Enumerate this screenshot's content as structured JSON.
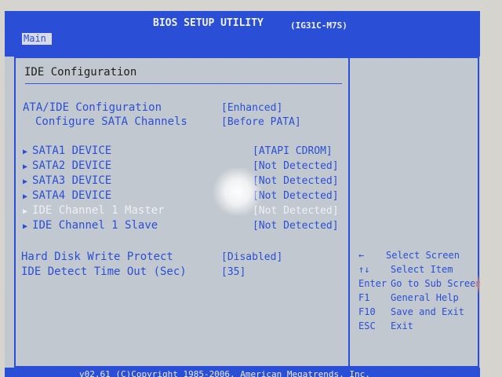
{
  "header": {
    "title": "BIOS SETUP UTILITY",
    "board": "(IG31C-M7S)"
  },
  "tabs": [
    {
      "label": "Main"
    }
  ],
  "section": {
    "title": "IDE Configuration"
  },
  "items": [
    {
      "label": "ATA/IDE Configuration",
      "value": "[Enhanced]"
    },
    {
      "label": "Configure SATA Channels",
      "value": "[Before PATA]"
    },
    {
      "label": "SATA1 DEVICE",
      "value": "[ATAPI CDROM]"
    },
    {
      "label": "SATA2 DEVICE",
      "value": "[Not Detected]"
    },
    {
      "label": "SATA3 DEVICE",
      "value": "[Not Detected]"
    },
    {
      "label": "SATA4 DEVICE",
      "value": "[Not Detected]"
    },
    {
      "label": "IDE Channel 1 Master",
      "value": "[Not Detected]"
    },
    {
      "label": "IDE Channel 1 Slave",
      "value": "[Not Detected]"
    },
    {
      "label": "Hard Disk Write Protect",
      "value": "[Disabled]"
    },
    {
      "label": "IDE Detect Time Out (Sec)",
      "value": "[35]"
    }
  ],
  "help": [
    {
      "key": "←",
      "desc": "Select Screen"
    },
    {
      "key": "↑↓",
      "desc": "Select Item"
    },
    {
      "key": "Enter",
      "desc": "Go to Sub Screen"
    },
    {
      "key": "F1",
      "desc": "General Help"
    },
    {
      "key": "F10",
      "desc": "Save and Exit"
    },
    {
      "key": "ESC",
      "desc": "Exit"
    }
  ],
  "footer": {
    "text": "v02.61 (C)Copyright 1985-2006, American Megatrends, Inc."
  },
  "colors": {
    "bios_blue": "#2a4fd6",
    "bios_gray": "#c2c8cf"
  },
  "icons": {
    "submenu": "triangle-right-icon"
  }
}
